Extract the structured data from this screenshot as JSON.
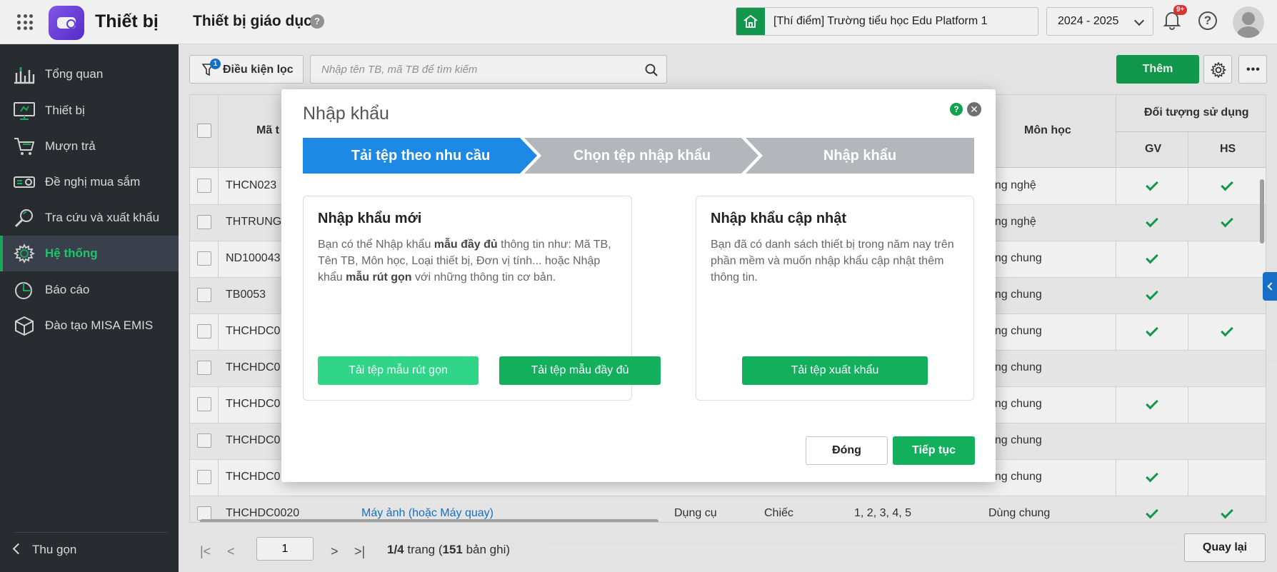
{
  "app": {
    "title": "Thiết bị"
  },
  "header": {
    "page_title": "Thiết bị giáo dục",
    "help_mark": "?",
    "school": "[Thí điểm] Trường tiểu học Edu Platform 1",
    "school_year": "2024 - 2025",
    "notification_count": "9+",
    "help_label": "?"
  },
  "sidebar": {
    "items": [
      {
        "label": "Tổng quan",
        "icon": "bar-chart-icon"
      },
      {
        "label": "Thiết bị",
        "icon": "monitor-icon"
      },
      {
        "label": "Mượn trả",
        "icon": "cart-icon"
      },
      {
        "label": "Đề nghị mua sắm",
        "icon": "projector-icon"
      },
      {
        "label": "Tra cứu và xuất khẩu",
        "icon": "search-icon"
      },
      {
        "label": "Hệ thống",
        "icon": "gear-icon",
        "active": true
      },
      {
        "label": "Báo cáo",
        "icon": "pie-chart-icon"
      },
      {
        "label": "Đào tạo MISA EMIS",
        "icon": "cube-icon"
      }
    ],
    "collapse_label": "Thu gọn"
  },
  "toolbar": {
    "filter_label": "Điều kiện lọc",
    "filter_count": "1",
    "search_placeholder": "Nhập tên TB, mã TB để tìm kiếm",
    "add_label": "Thêm",
    "more_label": "•••"
  },
  "table": {
    "headers": {
      "code_partial": "Mã t",
      "subject": "Môn học",
      "target_group": "Đối tượng sử dụng",
      "gv": "GV",
      "hs": "HS"
    },
    "rows": [
      {
        "code": "THCN023",
        "subject_partial": "ông nghệ",
        "gv": true,
        "hs": true
      },
      {
        "code": "THTRUNG",
        "subject_partial": "ông nghệ",
        "gv": true,
        "hs": true
      },
      {
        "code": "ND100043",
        "subject_partial": "ùng chung",
        "gv": true,
        "hs": false
      },
      {
        "code": "TB0053",
        "subject_partial": "ùng chung",
        "gv": true,
        "hs": false
      },
      {
        "code": "THCHDC0",
        "subject_partial": "ùng chung",
        "gv": true,
        "hs": true
      },
      {
        "code": "THCHDC0",
        "subject_partial": "ùng chung",
        "gv": false,
        "hs": false
      },
      {
        "code": "THCHDC0",
        "subject_partial": "ùng chung",
        "gv": true,
        "hs": false
      },
      {
        "code": "THCHDC0",
        "subject_partial": "ùng chung",
        "gv": false,
        "hs": false
      },
      {
        "code": "THCHDC0",
        "subject_partial": "ùng chung",
        "gv": true,
        "hs": false
      },
      {
        "code": "THCHDC0020",
        "name": "Máy ảnh (hoặc Máy quay)",
        "type": "Dụng cụ",
        "unit": "Chiếc",
        "grades": "1, 2, 3, 4, 5",
        "subject_partial": "Dùng chung",
        "gv": true,
        "hs": true
      }
    ]
  },
  "pagination": {
    "current_page": "1",
    "page_fraction": "1/4",
    "page_word": " trang (",
    "record_count": "151",
    "record_suffix": " bản ghi)",
    "back_label": "Quay lại"
  },
  "modal": {
    "title": "Nhập khẩu",
    "help_mark": "?",
    "close_mark": "✕",
    "steps": [
      "Tải tệp theo nhu cầu",
      "Chọn tệp nhập khẩu",
      "Nhập khẩu"
    ],
    "card_new": {
      "title": "Nhập khẩu mới",
      "desc_1": "Bạn có thể Nhập khẩu ",
      "desc_bold_1": "mẫu đầy đủ",
      "desc_2": " thông tin như: Mã TB, Tên TB, Môn học, Loại thiết bị, Đơn vị tính... hoặc Nhập khẩu ",
      "desc_bold_2": "mẫu rút gọn",
      "desc_3": " với những thông tin cơ bản.",
      "btn_short": "Tải tệp mẫu rút gọn",
      "btn_full": "Tải tệp mẫu đầy đủ"
    },
    "card_update": {
      "title": "Nhập khẩu cập nhật",
      "desc": "Bạn đã có danh sách thiết bị trong năm nay trên phần mềm và muốn nhập khẩu cập nhật thêm thông tin.",
      "btn_export": "Tải tệp xuất khẩu"
    },
    "close_label": "Đóng",
    "next_label": "Tiếp tục"
  },
  "colors": {
    "brand_green": "#12a150",
    "step_active": "#1e88e5",
    "step_inactive": "#b3b6bb",
    "sidebar_bg": "#2b2e33",
    "link_blue": "#1976d2"
  }
}
